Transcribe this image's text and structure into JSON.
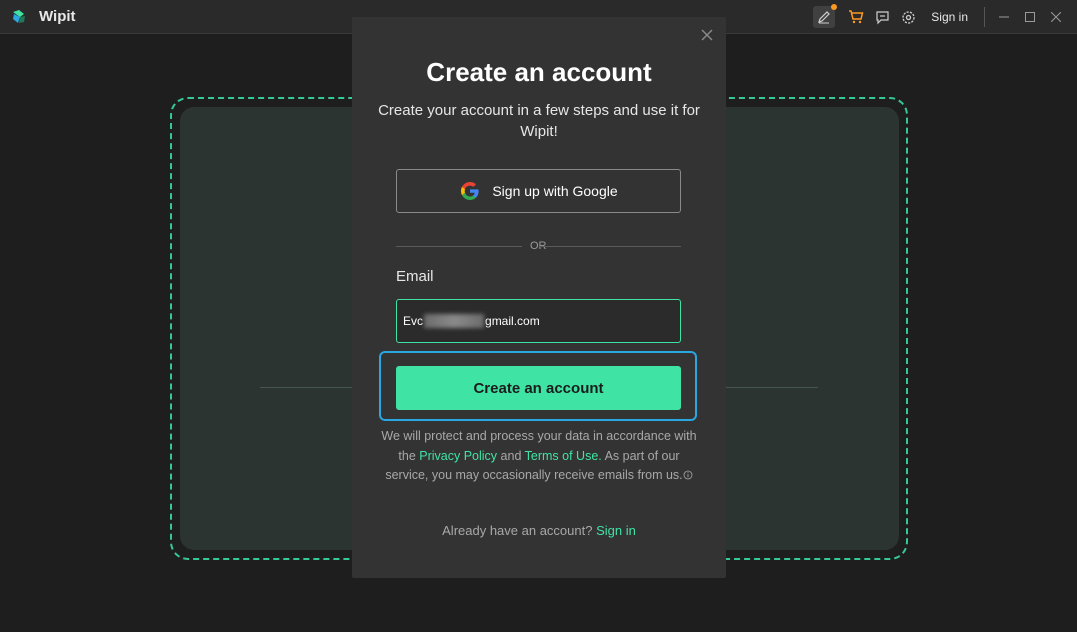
{
  "app": {
    "title": "Wipit",
    "signin_label": "Sign in"
  },
  "modal": {
    "title": "Create an account",
    "subtitle": "Create your account in a few steps and use it for Wipit!",
    "google_label": "Sign up with Google",
    "or_label": "OR",
    "email_label": "Email",
    "email_value_prefix": "Evc",
    "email_value_suffix": "gmail.com",
    "create_label": "Create an account",
    "policy": {
      "part1": "We will protect and process your data in accordance with the",
      "privacy_link": "Privacy Policy",
      "part2": "and",
      "terms_link": "Terms of Use.",
      "part3": "As part of our service, you may occasionally receive emails from us."
    },
    "already_text": "Already have an account?",
    "signin_link": "Sign in"
  },
  "colors": {
    "accent": "#3fe4a5",
    "focus": "#2aa6e0",
    "notification": "#ff9a1f"
  },
  "icons": [
    "app-logo-icon",
    "pen-icon",
    "cart-icon",
    "feedback-icon",
    "gear-icon",
    "minimize-icon",
    "maximize-icon",
    "close-icon",
    "google-icon",
    "info-icon"
  ]
}
